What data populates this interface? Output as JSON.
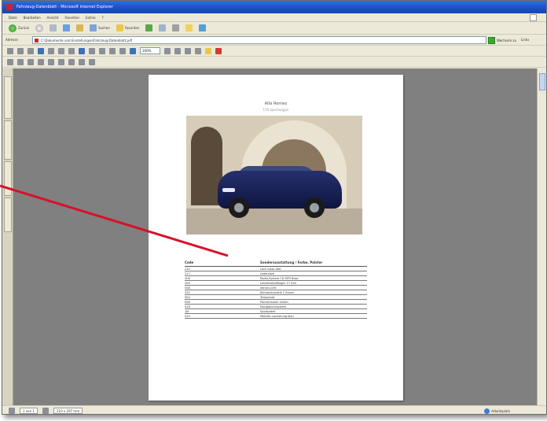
{
  "window": {
    "title": "Fahrzeug-Datenblatt - Microsoft Internet Explorer"
  },
  "menubar": {
    "items": [
      "Datei",
      "Bearbeiten",
      "Ansicht",
      "Favoriten",
      "Extras",
      "?"
    ]
  },
  "toolbar": {
    "back_label": "Zurück",
    "search_label": "Suchen",
    "favorites_label": "Favoriten"
  },
  "addressbar": {
    "label": "Adresse",
    "url": "C:\\Dokumente und Einstellungen\\Fahrzeug-Datenblatt.pdf",
    "go_label": "Wechseln zu",
    "links_label": "Links"
  },
  "pdf_toolbar": {
    "zoom_value": "100%"
  },
  "document": {
    "title": "Alfa Romeo",
    "subtitle": "159 Sportwagon",
    "table": {
      "headers": [
        "Code",
        "Sonderausstattung / Farbe, Polster"
      ],
      "rows": [
        [
          "210",
          "Lack rosso Alfa"
        ],
        [
          "217",
          "Ledersitze"
        ],
        [
          "4US",
          "Radio-System CD MP3 Bose"
        ],
        [
          "40G",
          "Leichtmetallfelgen 17 Zoll"
        ],
        [
          "5DE",
          "Xenon-Licht"
        ],
        [
          "320",
          "Klimaautomatik 2 Zonen"
        ],
        [
          "5EA",
          "Tempomat"
        ],
        [
          "008",
          "Parksensoren hinten"
        ],
        [
          "41D",
          "Navigationssystem"
        ],
        [
          "1JK",
          "Sportpaket"
        ],
        [
          "410",
          "Metallic-Lackierung blau"
        ]
      ]
    }
  },
  "statusbar": {
    "page_label": "1 von 1",
    "size_label": "210 x 297 mm",
    "zone_label": "Arbeitsplatz"
  },
  "colors": {
    "titlebar": "#1a4fc3",
    "viewer_bg": "#808080",
    "pointer_line": "#d8102a"
  }
}
